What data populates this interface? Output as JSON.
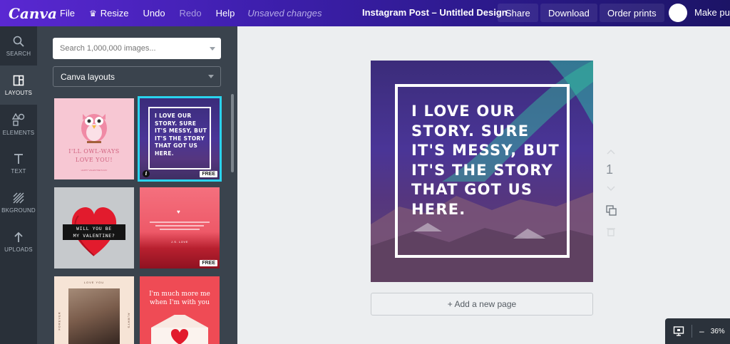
{
  "topbar": {
    "logo": "Canva",
    "menu": [
      "File",
      "Resize",
      "Undo",
      "Redo",
      "Help"
    ],
    "unsaved": "Unsaved changes",
    "doc_title": "Instagram Post – Untitled Design",
    "share": "Share",
    "download": "Download",
    "order_prints": "Order prints",
    "make_public": "Make public"
  },
  "rail": [
    {
      "label": "SEARCH",
      "icon": "search-icon"
    },
    {
      "label": "LAYOUTS",
      "icon": "layouts-icon"
    },
    {
      "label": "ELEMENTS",
      "icon": "elements-icon"
    },
    {
      "label": "TEXT",
      "icon": "text-icon"
    },
    {
      "label": "BKGROUND",
      "icon": "background-icon"
    },
    {
      "label": "UPLOADS",
      "icon": "uploads-icon"
    }
  ],
  "panel": {
    "search_placeholder": "Search 1,000,000 images...",
    "dropdown_value": "Canva layouts",
    "tiles": {
      "owl_line1": "I'LL OWL-WAYS",
      "owl_line2": "LOVE YOU!",
      "owl_small": "HAPPY VALENTINE'S DAY",
      "quote_small": "I LOVE OUR STORY. SURE IT'S MESSY, BUT IT'S THE STORY THAT GOT US HERE.",
      "valentine_line1": "WILL YOU BE",
      "valentine_line2": "MY VALENTINE?",
      "pink_author": "J.S. LOVE",
      "love_you": "LOVE YOU",
      "forever": "FOREVER",
      "always": "ALWAYS",
      "much_more_line1": "I'm much more me",
      "much_more_line2": "when I'm with you",
      "free": "FREE"
    }
  },
  "canvas": {
    "quote": "I LOVE OUR\nSTORY. SURE\nIT'S MESSY, BUT\nIT'S THE STORY\nTHAT GOT US\nHERE.",
    "add_page": "+ Add a new page",
    "page_number": "1"
  },
  "zoom": {
    "value": "36%",
    "minus": "–"
  }
}
